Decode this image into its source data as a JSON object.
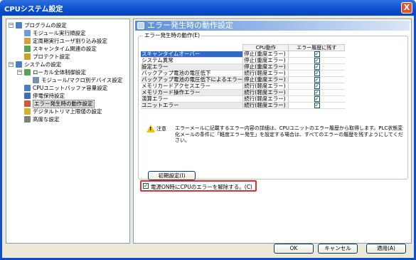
{
  "window": {
    "title": "CPUシステム設定",
    "close_label": "X"
  },
  "tree": {
    "nodes": [
      {
        "label": "プログラムの設定",
        "toggle": "−",
        "color": "#4a7fc1"
      },
      {
        "label": "モジュール実行順設定",
        "color": "#6c9bd6"
      },
      {
        "label": "定周期実行ユーザ割り込み設定",
        "color": "#d8a03a"
      },
      {
        "label": "スキャンタイム関連の設定",
        "color": "#5aa05a"
      },
      {
        "label": "プロテクト設定",
        "color": "#c9a227"
      },
      {
        "label": "システムの設定",
        "toggle": "−",
        "color": "#4a7fc1"
      },
      {
        "label": "ローカル全体制御設定",
        "toggle": "−",
        "color": "#5aa05a"
      },
      {
        "label": "モジュール/マクロ別デバイス設定",
        "color": "#7b8fb0"
      },
      {
        "label": "CPUユニットバッファ容量設定",
        "color": "#4a7fc1"
      },
      {
        "label": "停電保持設定",
        "color": "#3f6fb0"
      },
      {
        "label": "エラー発生時の動作設定",
        "color": "#d05a3a"
      },
      {
        "label": "デジタルトリマ上限値の設定",
        "color": "#d4b030"
      },
      {
        "label": "高度な設定",
        "color": "#7f7f7f"
      }
    ]
  },
  "content": {
    "header_title": "エラー発生時の動作設定",
    "group_title": "エラー発生時の動作(E)",
    "columns": {
      "mode": "CPU動作",
      "history": "エラー履歴に残す"
    },
    "rows": [
      {
        "name": "スキャンタイムオーバー",
        "mode": "停止(重度エラー)",
        "checked": "✔"
      },
      {
        "name": "システム異常",
        "mode": "停止(重度エラー)",
        "checked": "✔"
      },
      {
        "name": "設定エラー",
        "mode": "停止(重度エラー)",
        "checked": "✔"
      },
      {
        "name": "バックアップ電池の電圧低下",
        "mode": "続行(軽度エラー)",
        "checked": "✔"
      },
      {
        "name": "バックアップ電池の電圧低下によるエラー",
        "mode": "停止(重度エラー)",
        "checked": "✔"
      },
      {
        "name": "メモリカードアクセスエラー",
        "mode": "続行(軽度エラー)",
        "checked": "✔"
      },
      {
        "name": "メモリカード操作エラー",
        "mode": "続行(軽度エラー)",
        "checked": "✔"
      },
      {
        "name": "演算エラー",
        "mode": "続行(軽度エラー)",
        "checked": "✔"
      },
      {
        "name": "ユニットエラー",
        "mode": "続行(軽度エラー)",
        "checked": "✔"
      }
    ],
    "note_label": "注意",
    "note_text": "エラーメールに記載するエラー内容の詳細は、CPUユニットのエラー履歴から取得します。PLC状態変化メールの条件に「軽度エラー発生」を設定する場合は、すべてのエラーの履歴を残すようにしてください。",
    "init_button": "初期設定(I)",
    "clear_checkbox": {
      "checked": "✔",
      "label": "電源ON時にCPUのエラーを解除する。(C)"
    }
  },
  "footer": {
    "ok": "OK",
    "cancel": "キャンセル",
    "apply": "適用(A)"
  }
}
